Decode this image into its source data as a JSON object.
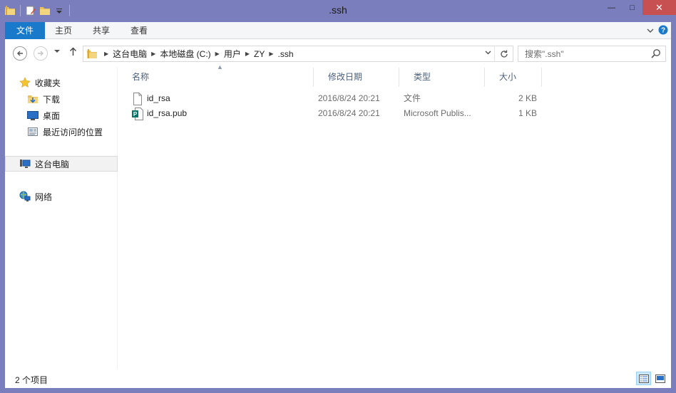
{
  "window": {
    "title": ".ssh",
    "controls": {
      "minimize": "—",
      "maximize": "□",
      "close": "✕"
    }
  },
  "ribbon": {
    "tabs": [
      {
        "label": "文件"
      },
      {
        "label": "主页"
      },
      {
        "label": "共享"
      },
      {
        "label": "查看"
      }
    ]
  },
  "address": {
    "breadcrumbs": [
      "这台电脑",
      "本地磁盘 (C:)",
      "用户",
      "ZY",
      ".ssh"
    ]
  },
  "search": {
    "placeholder": "搜索\".ssh\""
  },
  "sidebar": {
    "items": [
      {
        "label": "收藏夹",
        "icon": "star-icon"
      },
      {
        "label": "下载",
        "icon": "downloads-folder-icon"
      },
      {
        "label": "桌面",
        "icon": "desktop-icon"
      },
      {
        "label": "最近访问的位置",
        "icon": "recent-places-icon"
      },
      {
        "label": "这台电脑",
        "icon": "this-pc-icon",
        "selected": true
      },
      {
        "label": "网络",
        "icon": "network-icon"
      }
    ]
  },
  "filelist": {
    "columns": [
      {
        "label": "名称"
      },
      {
        "label": "修改日期"
      },
      {
        "label": "类型"
      },
      {
        "label": "大小"
      }
    ],
    "sort_indicator": "▲",
    "rows": [
      {
        "name": "id_rsa",
        "date": "2016/8/24 20:21",
        "type": "文件",
        "size": "2 KB",
        "icon": "blank-file-icon"
      },
      {
        "name": "id_rsa.pub",
        "date": "2016/8/24 20:21",
        "type": "Microsoft Publis...",
        "size": "1 KB",
        "icon": "publisher-file-icon"
      }
    ]
  },
  "status": {
    "item_count": "2 个项目"
  },
  "colors": {
    "titlebar": "#7b7ebd",
    "file_tab": "#1979ca",
    "close_button": "#c75050",
    "header_text": "#4c607a"
  }
}
